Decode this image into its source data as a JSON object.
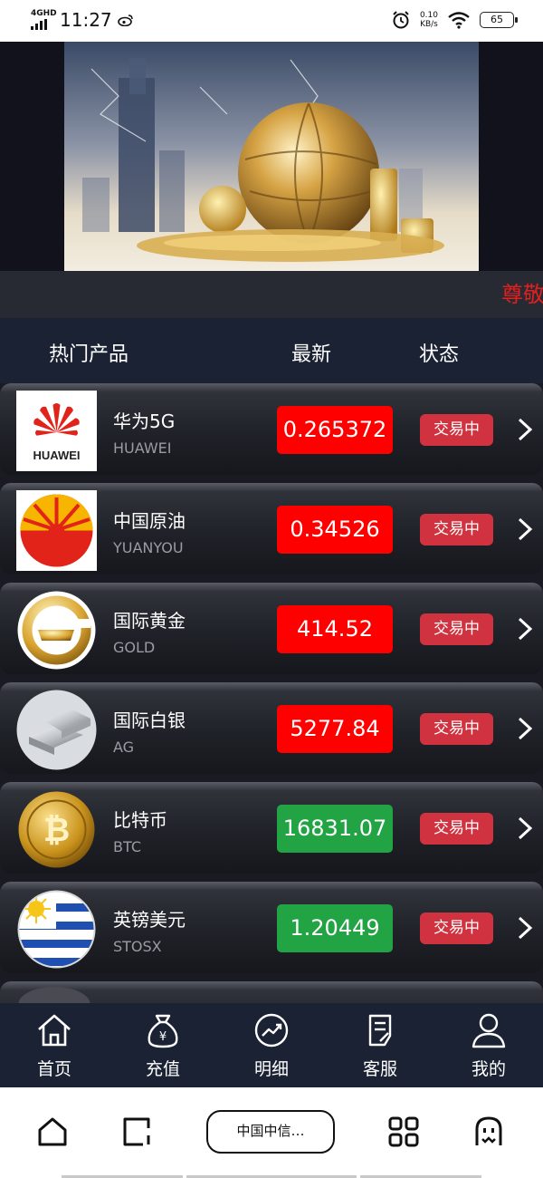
{
  "status_bar": {
    "network": "4GHD",
    "time": "11:27",
    "speed_value": "0.10",
    "speed_unit": "KB/s",
    "battery": "65"
  },
  "banner": {
    "icon": "finance-banner-image"
  },
  "marquee": {
    "text": "尊敬"
  },
  "table_header": {
    "product": "热门产品",
    "latest": "最新",
    "status": "状态"
  },
  "products": [
    {
      "name": "华为5G",
      "code": "HUAWEI",
      "price": "0.265372",
      "price_color": "#ff0000",
      "status": "交易中",
      "icon": "huawei-logo"
    },
    {
      "name": "中国原油",
      "code": "YUANYOU",
      "price": "0.34526",
      "price_color": "#ff0000",
      "status": "交易中",
      "icon": "cnpc-logo"
    },
    {
      "name": "国际黄金",
      "code": "GOLD",
      "price": "414.52",
      "price_color": "#ff0000",
      "status": "交易中",
      "icon": "gold-logo"
    },
    {
      "name": "国际白银",
      "code": "AG",
      "price": "5277.84",
      "price_color": "#ff0000",
      "status": "交易中",
      "icon": "silver-bars-image"
    },
    {
      "name": "比特币",
      "code": "BTC",
      "price": "16831.07",
      "price_color": "#22a344",
      "status": "交易中",
      "icon": "bitcoin-coin-image"
    },
    {
      "name": "英镑美元",
      "code": "STOSX",
      "price": "1.20449",
      "price_color": "#22a344",
      "status": "交易中",
      "icon": "uruguay-flag-image"
    }
  ],
  "app_nav": [
    {
      "label": "首页",
      "icon": "home-icon"
    },
    {
      "label": "充值",
      "icon": "money-bag-icon"
    },
    {
      "label": "明细",
      "icon": "trend-chart-icon"
    },
    {
      "label": "客服",
      "icon": "edit-document-icon"
    },
    {
      "label": "我的",
      "icon": "user-icon"
    }
  ],
  "browser_bar": {
    "url_label": "中国中信…"
  }
}
